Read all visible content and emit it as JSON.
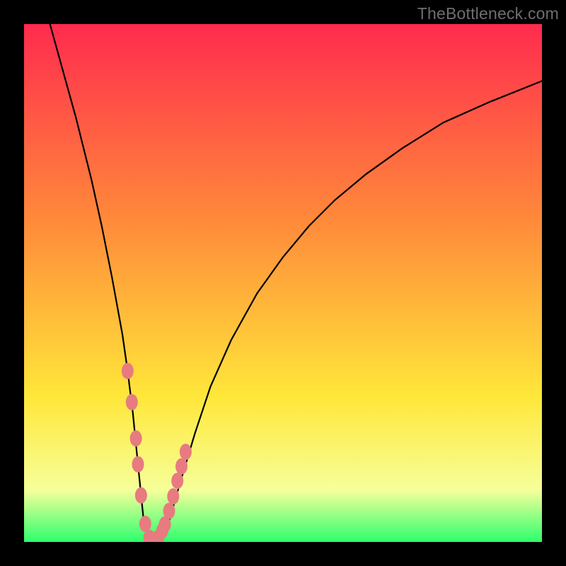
{
  "watermark": "TheBottleneck.com",
  "colors": {
    "frame": "#000000",
    "grad_top": "#ff2b4e",
    "grad_mid1": "#ff8a3a",
    "grad_mid2": "#ffe73a",
    "grad_band": "#f6ff9a",
    "grad_bottom": "#2dff6e",
    "curve": "#000000",
    "marker_fill": "#e77b80",
    "marker_stroke": "#cc5a60"
  },
  "chart_data": {
    "type": "line",
    "title": "",
    "xlabel": "",
    "ylabel": "",
    "xlim": [
      0,
      100
    ],
    "ylim": [
      0,
      100
    ],
    "note": "Axes are unlabeled in the source image; values are in percent of plot area, estimated from pixel positions.",
    "series": [
      {
        "name": "bottleneck-curve",
        "x": [
          5,
          10,
          13,
          15,
          17,
          19,
          20,
          21,
          22,
          23,
          24,
          25,
          26,
          27,
          28,
          30,
          33,
          36,
          40,
          45,
          50,
          55,
          60,
          66,
          73,
          81,
          90,
          100
        ],
        "values": [
          100,
          82,
          70,
          61,
          51,
          40,
          33,
          25,
          15,
          5,
          0.5,
          0,
          0.5,
          1.5,
          4,
          11,
          21,
          30,
          39,
          48,
          55,
          61,
          66,
          71,
          76,
          81,
          85,
          89
        ]
      }
    ],
    "markers": {
      "name": "highlighted-points",
      "x": [
        20.0,
        20.8,
        21.6,
        22.0,
        22.6,
        23.4,
        24.2,
        25.0,
        25.9,
        26.7,
        27.2,
        28.0,
        28.8,
        29.6,
        30.4,
        31.2
      ],
      "values": [
        33.0,
        27.0,
        20.0,
        15.0,
        9.0,
        3.5,
        0.8,
        0.2,
        0.8,
        2.2,
        3.4,
        6.0,
        8.8,
        11.8,
        14.6,
        17.4
      ]
    }
  }
}
